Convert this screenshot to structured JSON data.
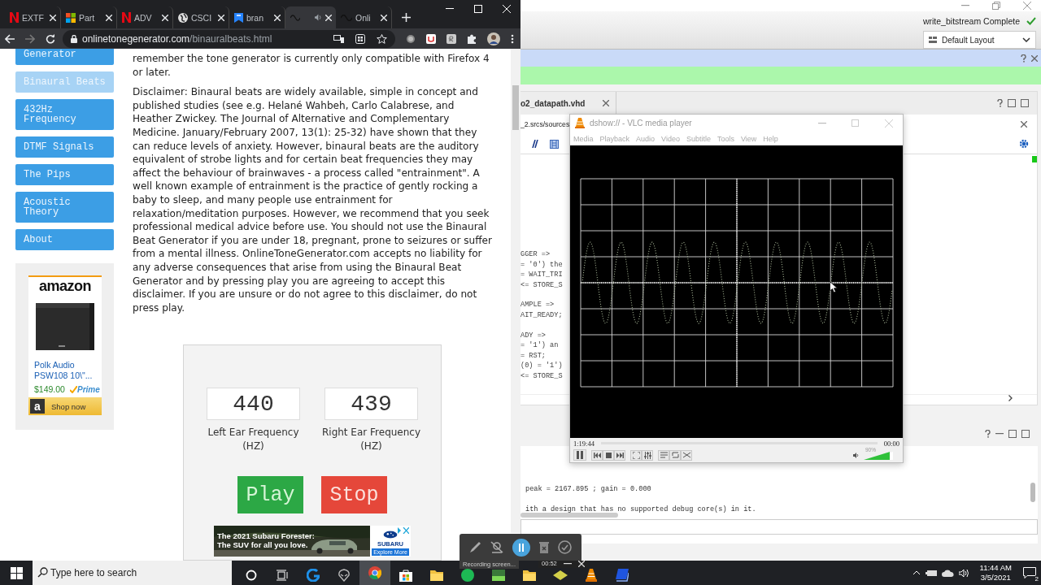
{
  "browser": {
    "tabs": [
      {
        "label": "EXTF",
        "kind": "brand",
        "selected": false,
        "audio": false
      },
      {
        "label": "Part",
        "kind": "windows",
        "selected": false,
        "audio": false
      },
      {
        "label": "ADV",
        "kind": "brand",
        "selected": false,
        "audio": false
      },
      {
        "label": "CSCI",
        "kind": "globe",
        "selected": false,
        "audio": false
      },
      {
        "label": "bran",
        "kind": "bookmark",
        "selected": false,
        "audio": false
      },
      {
        "kind": "wave",
        "selected": true,
        "audio": true
      },
      {
        "label": "Onli",
        "kind": "wave",
        "selected": false,
        "audio": false
      }
    ],
    "address": {
      "host": "onlinetonegenerator.com",
      "path": "/binauralbeats.html"
    }
  },
  "page": {
    "nav": [
      {
        "label": "Generator",
        "selected": false
      },
      {
        "label": "Binaural Beats",
        "selected": true
      },
      {
        "label": "432Hz Frequency",
        "selected": false
      },
      {
        "label": "DTMF Signals",
        "selected": false
      },
      {
        "label": "The Pips",
        "selected": false
      },
      {
        "label": "Acoustic Theory",
        "selected": false
      },
      {
        "label": "About",
        "selected": false
      }
    ],
    "ad": {
      "logo": "amazon",
      "product": "Polk Audio PSW108 10\\\"...",
      "price": "$149.00",
      "badge": "Prime",
      "button_icon": "a",
      "button": "Shop now"
    },
    "paragraphs": [
      "remember the tone generator is currently only compatible with Firefox 4 or later.",
      "Disclaimer: Binaural beats are widely available, simple in concept and published studies (see e.g. Helané Wahbeh, Carlo Calabrese, and Heather Zwickey. The Journal of Alternative and Complementary Medicine. January/February 2007, 13(1): 25-32) have shown that they can reduce levels of anxiety. However, binaural beats are the auditory equivalent of strobe lights and for certain beat frequencies they may affect the behaviour of brainwaves - a process called \"entrainment\". A well known example of entrainment is the practice of gently rocking a baby to sleep, and many people use entrainment for relaxation/meditation purposes. However, we recommend that you seek professional medical advice before use. You should not use the Binaural Beat Generator if you are under 18, pregnant, prone to seizures or suffer from a mental illness. OnlineToneGenerator.com accepts no liability for any adverse consequences that arise from using the Binaural Beat Generator and by pressing play you are agreeing to accept this disclaimer. If you are unsure or do not agree to this disclaimer, do not press play."
    ],
    "tone": {
      "fields": [
        {
          "value": "440",
          "label": "Left Ear Frequency (HZ)"
        },
        {
          "value": "439",
          "label": "Right Ear Frequency (HZ)"
        }
      ],
      "buttons": [
        {
          "label": "Play",
          "kind": "play"
        },
        {
          "label": "Stop",
          "kind": "stop"
        }
      ]
    },
    "banner": {
      "headline": "The 2021 Subaru Forester:",
      "tagline": "The SUV for all you love.",
      "brand": "SUBARU",
      "cta": "Explore More"
    }
  },
  "ide": {
    "status": "write_bitstream Complete",
    "layout": "Default Layout",
    "editor_tab": "o2_datapath.vhd",
    "path": "_2.srcs/sources",
    "code_blocks": [
      [
        "GGER =>",
        "= '0') the",
        "= WAIT_TRI",
        "<= STORE_S"
      ],
      [
        "AMPLE =>",
        "AIT_READY;"
      ],
      [
        "ADY =>",
        "= '1') an",
        "= RST;",
        "(0) = '1')",
        "<= STORE_S"
      ]
    ],
    "console": [
      "peak = 2167.895 ; gain = 0.000",
      "ith a design that has no supported debug core(s) in it."
    ]
  },
  "vlc": {
    "title": "dshow:// - VLC media player",
    "menu": [
      "Media",
      "Playback",
      "Audio",
      "Video",
      "Subtitle",
      "Tools",
      "View",
      "Help"
    ],
    "elapsed": "1:19:44",
    "total": "00:00",
    "volume": {
      "level": 0.9,
      "reading": "90%"
    }
  },
  "recorder": {
    "timer": "00:52",
    "tooltip": "Recording screen..."
  },
  "taskbar": {
    "search": {
      "placeholder": "Type here to search"
    },
    "apps": [
      {
        "kind": "cortana",
        "selected": false
      },
      {
        "kind": "taskview",
        "selected": false
      },
      {
        "kind": "logi",
        "selected": false
      },
      {
        "kind": "alien",
        "selected": false
      },
      {
        "kind": "chrome",
        "selected": true
      },
      {
        "kind": "store",
        "selected": false
      },
      {
        "kind": "folder",
        "selected": false
      },
      {
        "kind": "spotify",
        "selected": false
      },
      {
        "kind": "greenapp",
        "selected": false
      },
      {
        "kind": "folder",
        "selected": false
      },
      {
        "kind": "yellowapp",
        "selected": false
      },
      {
        "kind": "vlc",
        "selected": false
      },
      {
        "kind": "blueapp",
        "selected": false
      }
    ],
    "time": "11:44 AM",
    "date": "3/5/2021",
    "notifications": "2"
  }
}
